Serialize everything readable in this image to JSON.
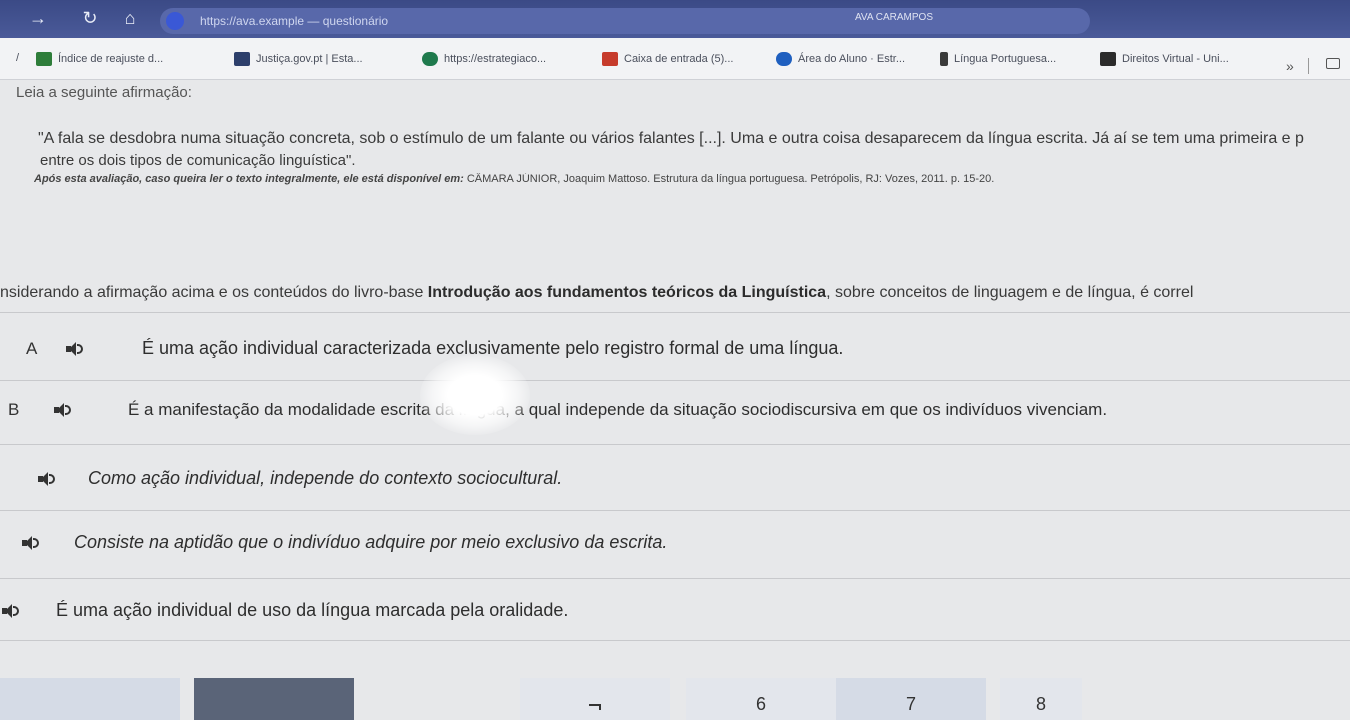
{
  "browser": {
    "address_text": "https://ava.example — questionário",
    "extension_label": "AVA CARAMPOS",
    "bookmarks": [
      {
        "label": "Índice de reajuste d...",
        "color": "#2e7d3a"
      },
      {
        "label": "Justiça.gov.pt | Esta...",
        "color": "#2d3f6b"
      },
      {
        "label": "https://estrategiaco...",
        "color": "#1f7a4d"
      },
      {
        "label": "Caixa de entrada (5)...",
        "color": "#c63b2b"
      },
      {
        "label": "Área do Aluno · Estr...",
        "color": "#1f5fbf"
      },
      {
        "label": "Língua Portuguesa...",
        "color": "#3a3a3a"
      },
      {
        "label": "Direitos Virtual - Uni...",
        "color": "#2b2b2b"
      }
    ],
    "more_label": "»"
  },
  "page": {
    "read_label": "Leia a seguinte afirmação:",
    "quote_line1": "\"A fala se desdobra numa situação concreta, sob o estímulo de um falante ou vários falantes [...]. Uma e outra coisa desaparecem da língua escrita. Já aí se tem uma primeira e p",
    "quote_line2": "entre os dois tipos de comunicação linguística\".",
    "source_bold": "Após esta avaliação, caso queira ler o texto integralmente, ele está disponível em:",
    "source_rest": " CÂMARA JÚNIOR, Joaquim Mattoso. Estrutura da língua portuguesa. Petrópolis, RJ: Vozes, 2011. p. 15-20.",
    "question_pre": "nsiderando a afirmação acima e os conteúdos do livro-base ",
    "question_book": "Introdução aos fundamentos teóricos da Linguística",
    "question_post": ", sobre conceitos de linguagem e de língua, é correl"
  },
  "options": [
    {
      "letter": "A",
      "text": "É uma ação individual caracterizada exclusivamente pelo registro formal de uma língua."
    },
    {
      "letter": "B",
      "text": "É a manifestação da modalidade escrita da língua, a qual independe da situação sociodiscursiva em que os indivíduos vivenciam."
    },
    {
      "letter": "",
      "text": "Como ação individual, independe do contexto sociocultural."
    },
    {
      "letter": "",
      "text": "Consiste na aptidão que o indivíduo adquire por meio exclusivo da escrita."
    },
    {
      "letter": "",
      "text": "É uma ação individual de uso da língua marcada pela oralidade."
    }
  ],
  "pager": {
    "pages": [
      "",
      "",
      "6",
      "7",
      "8"
    ],
    "active_index": 1
  }
}
